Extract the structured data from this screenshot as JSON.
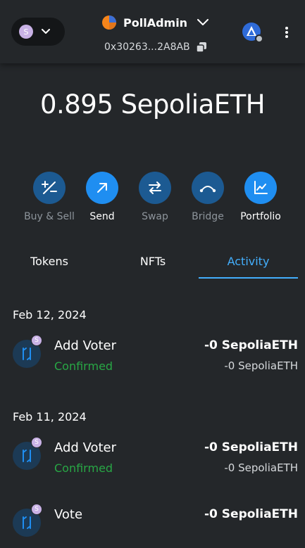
{
  "header": {
    "network_avatar_letter": "S",
    "account_name": "PollAdmin",
    "address": "0x30263...2A8AB"
  },
  "balance": {
    "amount": "0.895",
    "unit": "SepoliaETH"
  },
  "actions": [
    {
      "label": "Buy & Sell",
      "enabled": false,
      "icon": "buy-sell-icon"
    },
    {
      "label": "Send",
      "enabled": true,
      "icon": "send-arrow-icon"
    },
    {
      "label": "Swap",
      "enabled": false,
      "icon": "swap-arrows-icon"
    },
    {
      "label": "Bridge",
      "enabled": false,
      "icon": "bridge-icon"
    },
    {
      "label": "Portfolio",
      "enabled": true,
      "icon": "chart-icon"
    }
  ],
  "tabs": [
    {
      "label": "Tokens",
      "active": false
    },
    {
      "label": "NFTs",
      "active": false
    },
    {
      "label": "Activity",
      "active": true
    }
  ],
  "activity": {
    "groups": [
      {
        "date": "Feb 12, 2024",
        "items": [
          {
            "badge": "S",
            "title": "Add Voter",
            "status": "Confirmed",
            "amount": "-0 SepoliaETH",
            "fiat": "-0 SepoliaETH"
          }
        ]
      },
      {
        "date": "Feb 11, 2024",
        "items": [
          {
            "badge": "S",
            "title": "Add Voter",
            "status": "Confirmed",
            "amount": "-0 SepoliaETH",
            "fiat": "-0 SepoliaETH"
          },
          {
            "badge": "S",
            "title": "Vote",
            "status": "",
            "amount": "-0 SepoliaETH",
            "fiat": ""
          }
        ]
      }
    ]
  },
  "colors": {
    "background": "#24272a",
    "accent": "#43aefc",
    "primary_button": "#1f8ef1",
    "disabled_button": "#1c5a92",
    "confirmed": "#28a745",
    "network_avatar": "#c9b2e6"
  }
}
